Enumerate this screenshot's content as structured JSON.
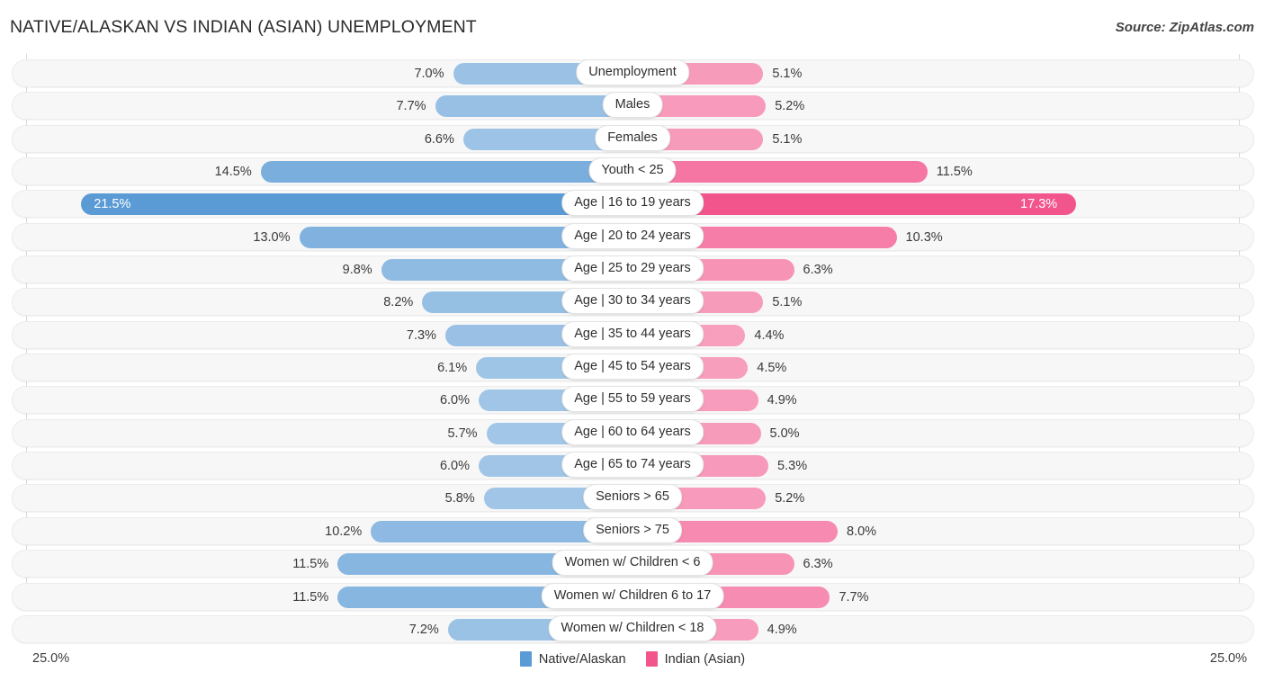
{
  "header": {
    "title": "NATIVE/ALASKAN VS INDIAN (ASIAN) UNEMPLOYMENT",
    "source": "Source: ZipAtlas.com"
  },
  "footer": {
    "axis_left_label": "25.0%",
    "axis_right_label": "25.0%"
  },
  "legend": {
    "items": [
      {
        "label": "Native/Alaskan",
        "color": "#5b9bd5"
      },
      {
        "label": "Indian (Asian)",
        "color": "#f2558c"
      }
    ]
  },
  "chart_data": {
    "type": "bar",
    "orientation": "horizontal-diverging",
    "title": "NATIVE/ALASKAN VS INDIAN (ASIAN) UNEMPLOYMENT",
    "source": "Source: ZipAtlas.com",
    "xlabel": "",
    "ylabel": "",
    "axis_max_percent": 25.0,
    "axis_left_label": "25.0%",
    "axis_right_label": "25.0%",
    "grid": false,
    "legend_position": "bottom-center",
    "categories": [
      "Unemployment",
      "Males",
      "Females",
      "Youth < 25",
      "Age | 16 to 19 years",
      "Age | 20 to 24 years",
      "Age | 25 to 29 years",
      "Age | 30 to 34 years",
      "Age | 35 to 44 years",
      "Age | 45 to 54 years",
      "Age | 55 to 59 years",
      "Age | 60 to 64 years",
      "Age | 65 to 74 years",
      "Seniors > 65",
      "Seniors > 75",
      "Women w/ Children < 6",
      "Women w/ Children 6 to 17",
      "Women w/ Children < 18"
    ],
    "series": [
      {
        "name": "Native/Alaskan",
        "side": "left",
        "color": "#5b9bd5",
        "values": [
          7.0,
          7.7,
          6.6,
          14.5,
          21.5,
          13.0,
          9.8,
          8.2,
          7.3,
          6.1,
          6.0,
          5.7,
          6.0,
          5.8,
          10.2,
          11.5,
          11.5,
          7.2
        ],
        "labels": [
          "7.0%",
          "7.7%",
          "6.6%",
          "14.5%",
          "21.5%",
          "13.0%",
          "9.8%",
          "8.2%",
          "7.3%",
          "6.1%",
          "6.0%",
          "5.7%",
          "6.0%",
          "5.8%",
          "10.2%",
          "11.5%",
          "11.5%",
          "7.2%"
        ]
      },
      {
        "name": "Indian (Asian)",
        "side": "right",
        "color": "#f2558c",
        "values": [
          5.1,
          5.2,
          5.1,
          11.5,
          17.3,
          10.3,
          6.3,
          5.1,
          4.4,
          4.5,
          4.9,
          5.0,
          5.3,
          5.2,
          8.0,
          6.3,
          7.7,
          4.9
        ],
        "labels": [
          "5.1%",
          "5.2%",
          "5.1%",
          "11.5%",
          "17.3%",
          "10.3%",
          "6.3%",
          "5.1%",
          "4.4%",
          "4.5%",
          "4.9%",
          "5.0%",
          "5.3%",
          "5.2%",
          "8.0%",
          "6.3%",
          "7.7%",
          "4.9%"
        ]
      }
    ]
  }
}
